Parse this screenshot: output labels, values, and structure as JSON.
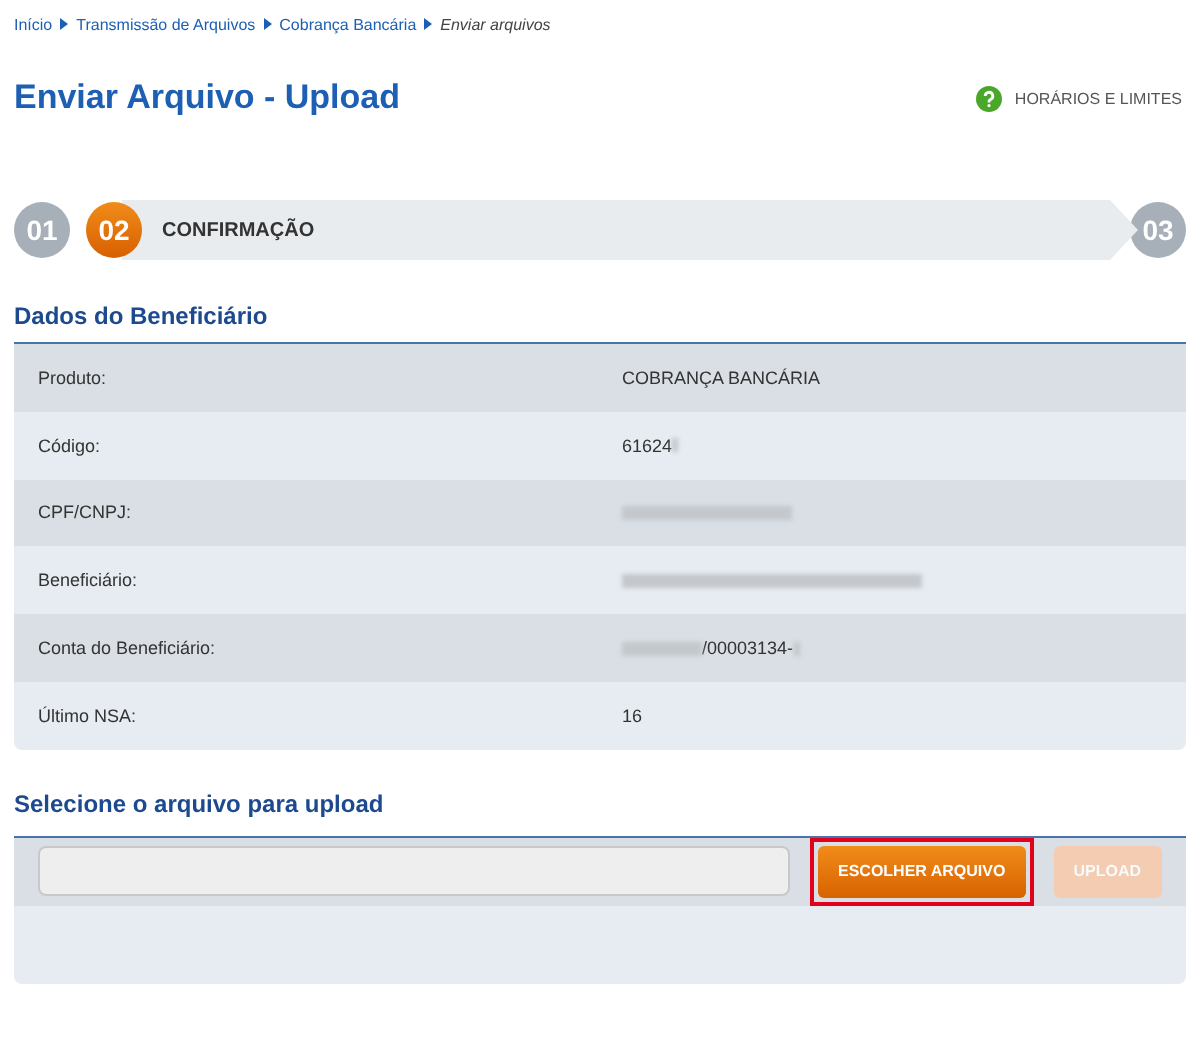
{
  "breadcrumb": [
    {
      "label": "Início",
      "current": false
    },
    {
      "label": "Transmissão de Arquivos",
      "current": false
    },
    {
      "label": "Cobrança Bancária",
      "current": false
    },
    {
      "label": "Enviar arquivos",
      "current": true
    }
  ],
  "title": "Enviar Arquivo - Upload",
  "help_link": "HORÁRIOS E LIMITES",
  "steps": [
    {
      "number": "01",
      "selected": false
    },
    {
      "number": "02",
      "selected": true,
      "label": "CONFIRMAÇÃO"
    },
    {
      "number": "03",
      "selected": false
    }
  ],
  "beneficiary": {
    "heading": "Dados do Beneficiário",
    "rows": [
      {
        "label": "Produto:",
        "value": "COBRANÇA BANCÁRIA"
      },
      {
        "label": "Código:",
        "value": "61624",
        "blur_after": true
      },
      {
        "label": "CPF/CNPJ:",
        "blur_before": true
      },
      {
        "label": "Beneficiário:",
        "blur_before": true
      },
      {
        "label": "Conta do Beneficiário:",
        "value": "/00003134-",
        "blur_before": true,
        "blur_after": true
      },
      {
        "label": "Último NSA:",
        "value": "16"
      }
    ]
  },
  "upload": {
    "heading": "Selecione o arquivo para upload",
    "choose_button": {
      "label": "ESCOLHER ARQUIVO",
      "highlighted": true
    },
    "upload_button": {
      "label": "UPLOAD",
      "disabled": true
    }
  }
}
